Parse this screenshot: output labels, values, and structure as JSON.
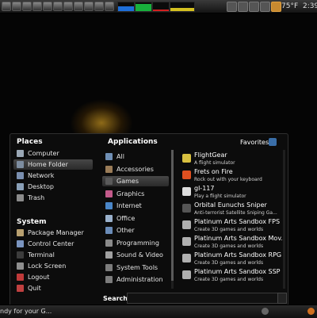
{
  "top_panel": {
    "weather": "75°F",
    "clock": "2:39",
    "graph_colors": {
      "cpu": "#1e6fd9",
      "memory": "#18b03c",
      "network": "#d22020",
      "load": "#d4c020"
    }
  },
  "menu": {
    "places": {
      "title": "Places",
      "items": [
        {
          "label": "Computer",
          "icon": "computer-icon",
          "color": "#9aa7b5"
        },
        {
          "label": "Home Folder",
          "icon": "home-folder-icon",
          "color": "#7d8da0"
        },
        {
          "label": "Network",
          "icon": "network-icon",
          "color": "#7a8fb0"
        },
        {
          "label": "Desktop",
          "icon": "desktop-icon",
          "color": "#8aa0b8"
        },
        {
          "label": "Trash",
          "icon": "trash-icon",
          "color": "#8b8b8b"
        }
      ]
    },
    "system": {
      "title": "System",
      "items": [
        {
          "label": "Package Manager",
          "icon": "package-manager-icon",
          "color": "#b8a070"
        },
        {
          "label": "Control Center",
          "icon": "control-center-icon",
          "color": "#7b95c0"
        },
        {
          "label": "Terminal",
          "icon": "terminal-icon",
          "color": "#3c3c3c"
        },
        {
          "label": "Lock Screen",
          "icon": "lock-screen-icon",
          "color": "#8f8f8f"
        },
        {
          "label": "Logout",
          "icon": "logout-icon",
          "color": "#c03a3a"
        },
        {
          "label": "Quit",
          "icon": "quit-icon",
          "color": "#c04040"
        }
      ]
    },
    "applications": {
      "title": "Applications",
      "items": [
        {
          "label": "All",
          "icon": "all-icon",
          "color": "#6f8fb5"
        },
        {
          "label": "Accessories",
          "icon": "accessories-icon",
          "color": "#9a7c58"
        },
        {
          "label": "Games",
          "icon": "games-icon",
          "color": "#5a5a5a"
        },
        {
          "label": "Graphics",
          "icon": "graphics-icon",
          "color": "#c25a8a"
        },
        {
          "label": "Internet",
          "icon": "internet-icon",
          "color": "#4a86c8"
        },
        {
          "label": "Office",
          "icon": "office-icon",
          "color": "#9ab1cc"
        },
        {
          "label": "Other",
          "icon": "other-icon",
          "color": "#6a8cb8"
        },
        {
          "label": "Programming",
          "icon": "programming-icon",
          "color": "#8a8a8a"
        },
        {
          "label": "Sound & Video",
          "icon": "sound-video-icon",
          "color": "#a0a0a0"
        },
        {
          "label": "System Tools",
          "icon": "system-tools-icon",
          "color": "#7c7c7c"
        },
        {
          "label": "Administration",
          "icon": "administration-icon",
          "color": "#7c7c7c"
        }
      ]
    },
    "favorites": {
      "label": "Favorites"
    },
    "programs": [
      {
        "name": "FlightGear",
        "desc": "A flight simulator",
        "icon": "flightgear-icon",
        "color": "#d8c040"
      },
      {
        "name": "Frets on Fire",
        "desc": "Rock out with your keyboard",
        "icon": "frets-on-fire-icon",
        "color": "#e05020"
      },
      {
        "name": "gl-117",
        "desc": "Play a flight simulator",
        "icon": "gl-117-icon",
        "color": "#dddddd"
      },
      {
        "name": "Orbital Eunuchs Sniper",
        "desc": "Anti-terrorist Satellite Sniping Ga...",
        "icon": "orbital-eunuchs-sniper-icon",
        "color": "#555555"
      },
      {
        "name": "Platinum Arts Sandbox FPS",
        "desc": "Create 3D games and worlds",
        "icon": "sandbox-fps-icon",
        "color": "#b0b0b0"
      },
      {
        "name": "Platinum Arts Sandbox Mov...",
        "desc": "Create 3D games and worlds",
        "icon": "sandbox-movie-icon",
        "color": "#b0b0b0"
      },
      {
        "name": "Platinum Arts Sandbox RPG",
        "desc": "Create 3D games and worlds",
        "icon": "sandbox-rpg-icon",
        "color": "#b0b0b0"
      },
      {
        "name": "Platinum Arts Sandbox SSP",
        "desc": "Create 3D games and worlds",
        "icon": "sandbox-ssp-icon",
        "color": "#b0b0b0"
      }
    ],
    "search": {
      "label": "Search:",
      "value": ""
    }
  },
  "taskbar": {
    "window_text": "ndy for your G..."
  }
}
